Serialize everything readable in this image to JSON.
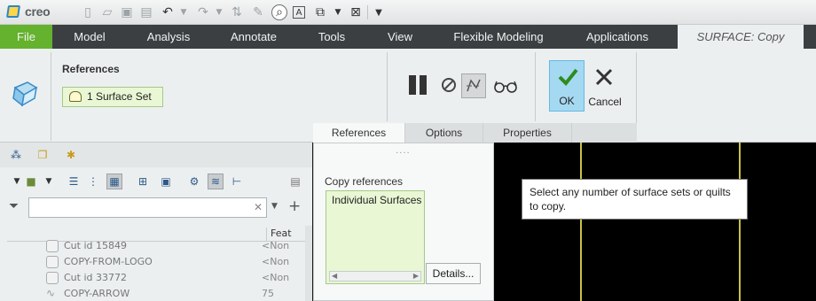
{
  "app": {
    "logo_text": "creo",
    "colors": {
      "accent_green": "#64b22d",
      "ok_blue": "#a5d9f2",
      "selection_green": "#e9f7d4"
    }
  },
  "quick_access": {
    "icons": [
      "new-icon",
      "open-icon",
      "save-icon",
      "save-as-icon",
      "undo-icon",
      "dropdown-icon",
      "redo-icon",
      "dropdown-icon",
      "regenerate-icon",
      "settings-icon",
      "zoom-icon",
      "text-icon",
      "windows-icon",
      "dropdown-icon",
      "close-window-icon",
      "customize-icon"
    ]
  },
  "ribbon_tabs": [
    {
      "label": "File"
    },
    {
      "label": "Model"
    },
    {
      "label": "Analysis"
    },
    {
      "label": "Annotate"
    },
    {
      "label": "Tools"
    },
    {
      "label": "View"
    },
    {
      "label": "Flexible Modeling"
    },
    {
      "label": "Applications"
    }
  ],
  "active_feature_tab": "SURFACE: Copy",
  "ribbon": {
    "references_title": "References",
    "reference_collector": "1 Surface Set",
    "ok_label": "OK",
    "cancel_label": "Cancel"
  },
  "dashboard_tabs": [
    {
      "label": "References",
      "active": true
    },
    {
      "label": "Options",
      "active": false
    },
    {
      "label": "Properties",
      "active": false
    }
  ],
  "model_tree": {
    "filter_placeholder": "",
    "column_header": "Feat",
    "rows": [
      {
        "label": "Cut id 15849",
        "value": "<Non"
      },
      {
        "label": "COPY-FROM-LOGO",
        "value": "<Non"
      },
      {
        "label": "Cut id 33772",
        "value": "<Non"
      },
      {
        "label": "COPY-ARROW",
        "value": "75"
      }
    ]
  },
  "references_panel": {
    "grip": "....",
    "title": "Copy references",
    "list_item": "Individual Surfaces",
    "details_button": "Details..."
  },
  "graphics": {
    "tooltip": "Select any number of surface sets or quilts to copy."
  }
}
